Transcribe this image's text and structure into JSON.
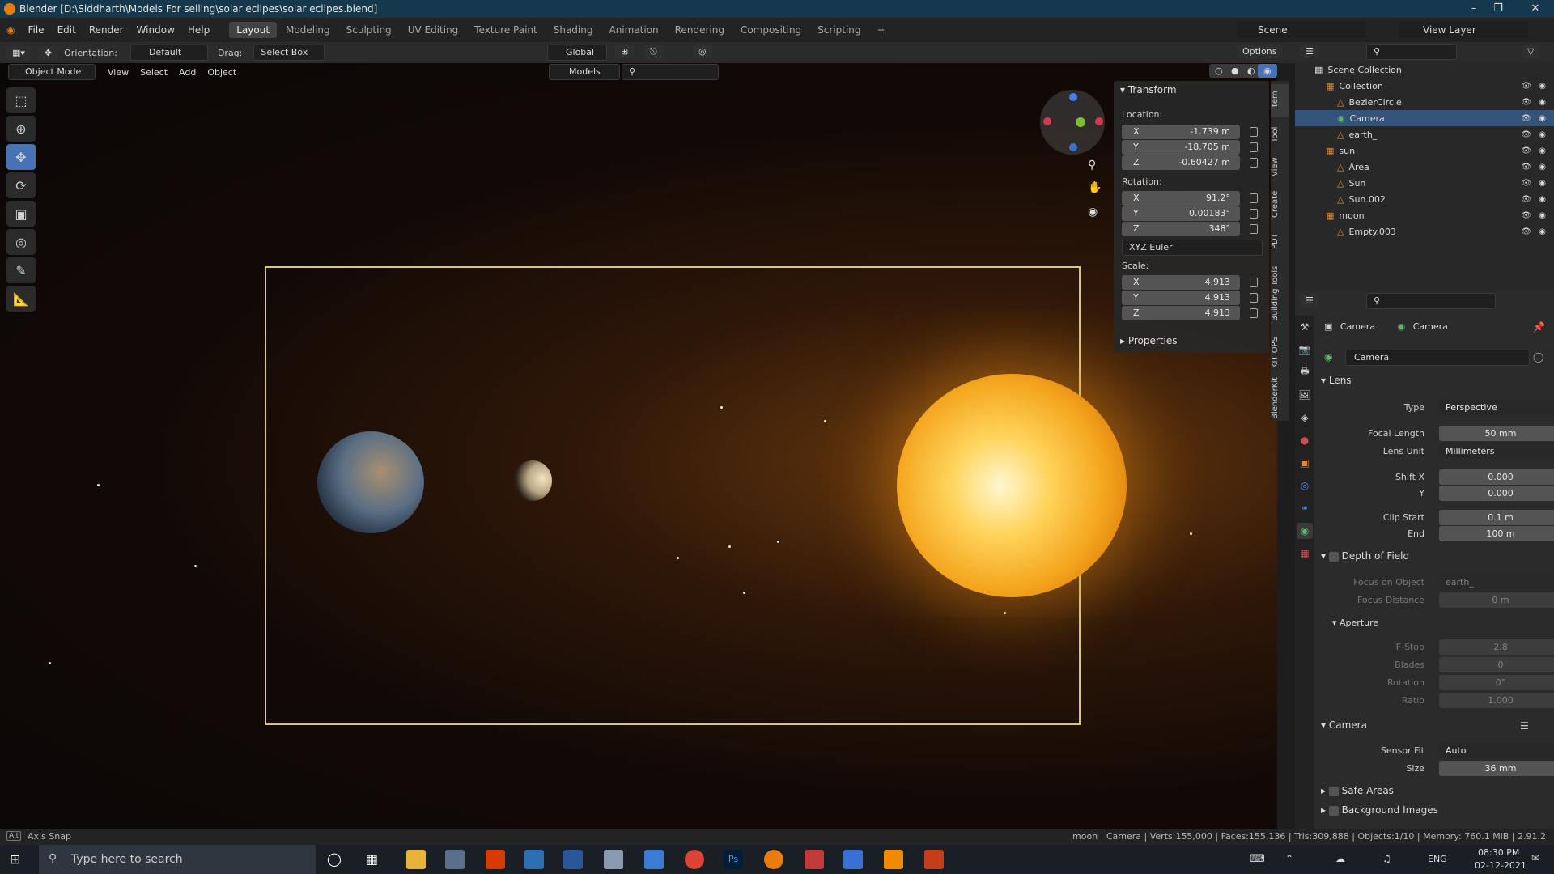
{
  "window": {
    "title": "Blender [D:\\Siddharth\\Models For selling\\solar eclipes\\solar eclipes.blend]"
  },
  "menus": [
    "File",
    "Edit",
    "Render",
    "Window",
    "Help"
  ],
  "workspaces": [
    "Layout",
    "Modeling",
    "Sculpting",
    "UV Editing",
    "Texture Paint",
    "Shading",
    "Animation",
    "Rendering",
    "Compositing",
    "Scripting"
  ],
  "active_workspace": "Layout",
  "scene": "Scene",
  "view_layer": "View Layer",
  "header": {
    "orientation_label": "Orientation:",
    "orientation": "Default",
    "drag_label": "Drag:",
    "drag": "Select Box",
    "transform": "Global",
    "options": "Options"
  },
  "viewport_header": {
    "mode": "Object Mode",
    "view": "View",
    "select": "Select",
    "add": "Add",
    "object": "Object",
    "collection": "Models"
  },
  "transform": {
    "title": "Transform",
    "location_label": "Location:",
    "location": {
      "x": "-1.739 m",
      "y": "-18.705 m",
      "z": "-0.60427 m"
    },
    "rotation_label": "Rotation:",
    "rotation": {
      "x": "91.2°",
      "y": "0.00183°",
      "z": "348°"
    },
    "rotation_mode": "XYZ Euler",
    "scale_label": "Scale:",
    "scale": {
      "x": "4.913",
      "y": "4.913",
      "z": "4.913"
    },
    "properties": "Properties",
    "axis": {
      "x": "X",
      "y": "Y",
      "z": "Z"
    }
  },
  "side_tabs": [
    "Item",
    "Tool",
    "View",
    "Create",
    "PDT",
    "Building Tools",
    "KIT OPS",
    "BlenderKit"
  ],
  "outliner": {
    "root": "Scene Collection",
    "rows": [
      {
        "name": "Collection",
        "indent": 1
      },
      {
        "name": "BezierCircle",
        "indent": 2
      },
      {
        "name": "Camera",
        "indent": 2,
        "selected": true
      },
      {
        "name": "earth_",
        "indent": 2
      },
      {
        "name": "sun",
        "indent": 1
      },
      {
        "name": "Area",
        "indent": 2
      },
      {
        "name": "Sun",
        "indent": 2
      },
      {
        "name": "Sun.002",
        "indent": 2
      },
      {
        "name": "moon",
        "indent": 1
      },
      {
        "name": "Empty.003",
        "indent": 2
      }
    ]
  },
  "properties": {
    "breadcrumb_object": "Camera",
    "breadcrumb_data": "Camera",
    "datablock": "Camera",
    "lens": {
      "title": "Lens",
      "type_label": "Type",
      "type": "Perspective",
      "focal_label": "Focal Length",
      "focal": "50 mm",
      "unit_label": "Lens Unit",
      "unit": "Millimeters",
      "shiftx_label": "Shift X",
      "shiftx": "0.000",
      "shifty_label": "Y",
      "shifty": "0.000",
      "clipstart_label": "Clip Start",
      "clipstart": "0.1 m",
      "clipend_label": "End",
      "clipend": "100 m"
    },
    "dof": {
      "title": "Depth of Field",
      "focus_obj_label": "Focus on Object",
      "focus_obj": "earth_",
      "focus_dist_label": "Focus Distance",
      "focus_dist": "0 m",
      "aperture": "Aperture",
      "fstop_label": "F-Stop",
      "fstop": "2.8",
      "blades_label": "Blades",
      "blades": "0",
      "rotation_label": "Rotation",
      "rotation": "0°",
      "ratio_label": "Ratio",
      "ratio": "1.000"
    },
    "camera": {
      "title": "Camera",
      "sensorfit_label": "Sensor Fit",
      "sensorfit": "Auto",
      "size_label": "Size",
      "size": "36 mm"
    },
    "safe_areas": "Safe Areas",
    "background_images": "Background Images"
  },
  "status": {
    "left_key": "Alt",
    "left": "Axis Snap",
    "right": "moon | Camera | Verts:155,000 | Faces:155,136 | Tris:309,888 | Objects:1/10 | Memory: 760.1 MiB | 2.91.2"
  },
  "taskbar": {
    "search": "Type here to search",
    "lang": "ENG",
    "time": "08:30 PM",
    "date": "02-12-2021"
  },
  "colors": {
    "accent": "#4772b3",
    "selection": "#34537a",
    "camera_frame": "#d8c97a"
  }
}
